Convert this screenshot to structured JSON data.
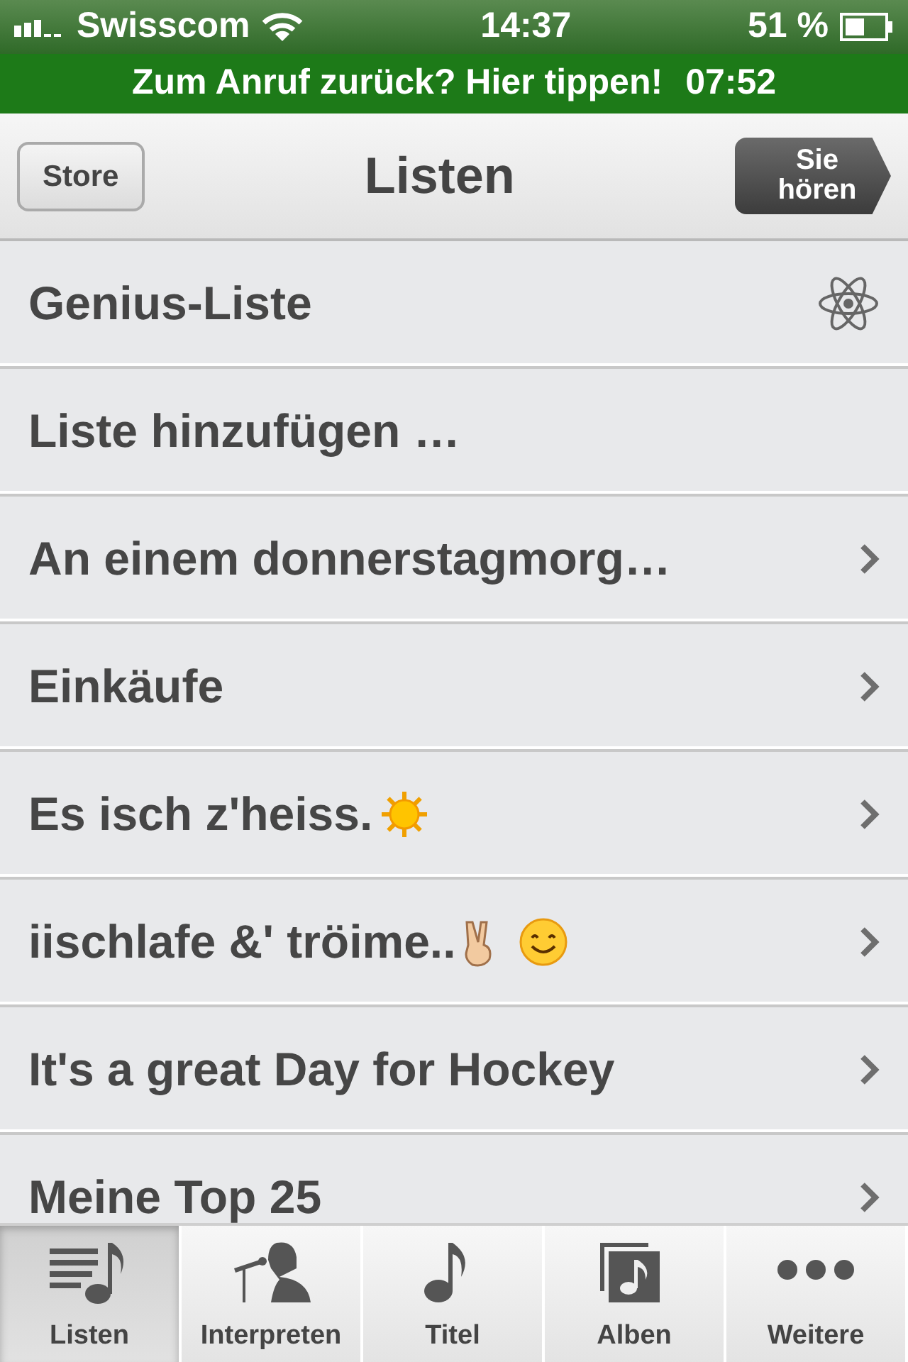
{
  "status_bar": {
    "carrier": "Swisscom",
    "time": "14:37",
    "battery": "51 %"
  },
  "call_banner": {
    "text": "Zum Anruf zurück? Hier tippen!",
    "duration": "07:52"
  },
  "nav_bar": {
    "left_button": "Store",
    "title": "Listen",
    "right_button": "Sie hören"
  },
  "rows": [
    {
      "label": "Genius-Liste",
      "kind": "genius"
    },
    {
      "label": "Liste hinzufügen …",
      "kind": "action"
    },
    {
      "label": "An einem donnerstagmorg…",
      "kind": "playlist"
    },
    {
      "label": "Einkäufe",
      "kind": "playlist"
    },
    {
      "label": "Es isch z'heiss.",
      "kind": "playlist",
      "emoji": [
        {
          "kind": "sun"
        }
      ]
    },
    {
      "label": "iischlafe &' tröime..",
      "kind": "playlist",
      "emoji": [
        {
          "kind": "victory"
        },
        {
          "kind": "smile"
        }
      ]
    },
    {
      "label": "It's a great Day for Hockey",
      "kind": "playlist"
    },
    {
      "label": "Meine Top 25",
      "kind": "playlist"
    }
  ],
  "tab_bar": [
    {
      "label": "Listen",
      "kind": "playlist",
      "selected": true
    },
    {
      "label": "Interpreten",
      "kind": "artist",
      "selected": false
    },
    {
      "label": "Titel",
      "kind": "note",
      "selected": false
    },
    {
      "label": "Alben",
      "kind": "album",
      "selected": false
    },
    {
      "label": "Weitere",
      "kind": "more",
      "selected": false
    }
  ]
}
